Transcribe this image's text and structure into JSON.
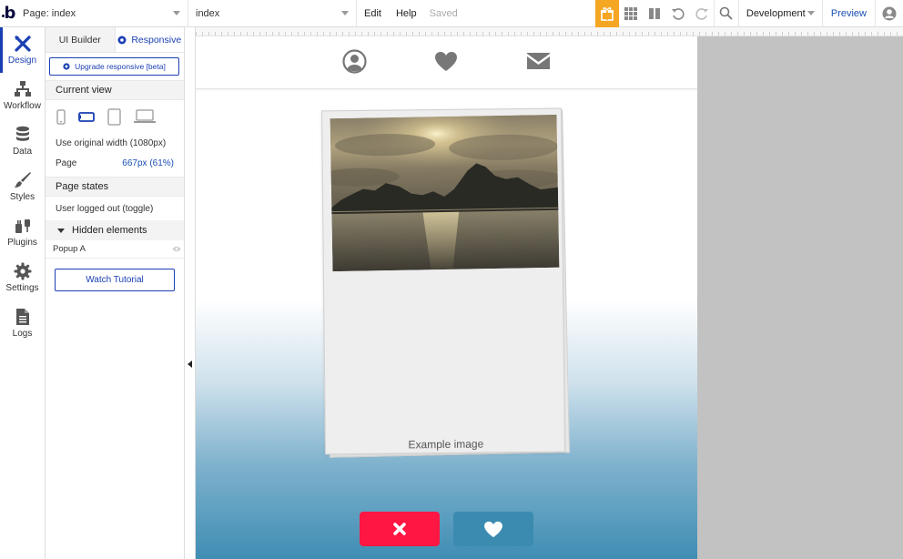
{
  "topbar": {
    "logo": "b",
    "page_selector": "Page: index",
    "element_selector": "index",
    "menu_edit": "Edit",
    "menu_help": "Help",
    "save_status": "Saved",
    "mode": "Development",
    "preview": "Preview"
  },
  "rail": {
    "items": [
      {
        "label": "Design",
        "icon": "design-icon"
      },
      {
        "label": "Workflow",
        "icon": "workflow-icon"
      },
      {
        "label": "Data",
        "icon": "database-icon"
      },
      {
        "label": "Styles",
        "icon": "brush-icon"
      },
      {
        "label": "Plugins",
        "icon": "plug-icon"
      },
      {
        "label": "Settings",
        "icon": "gear-icon"
      },
      {
        "label": "Logs",
        "icon": "document-icon"
      }
    ]
  },
  "panel": {
    "tabs": [
      "UI Builder",
      "Responsive"
    ],
    "upgrade_label": "Upgrade responsive [beta]",
    "current_view_heading": "Current view",
    "original_width": "Use original width (1080px)",
    "page_label": "Page",
    "page_value": "667px (61%)",
    "page_states_heading": "Page states",
    "page_state": "User logged out (toggle)",
    "hidden_heading": "Hidden elements",
    "hidden_item": "Popup A",
    "tutorial_label": "Watch Tutorial"
  },
  "canvas": {
    "caption": "Example image"
  },
  "colors": {
    "accent": "#1a3fb3",
    "gift": "#f5a623",
    "nope": "#ff1744",
    "like": "#3b8ab0"
  }
}
